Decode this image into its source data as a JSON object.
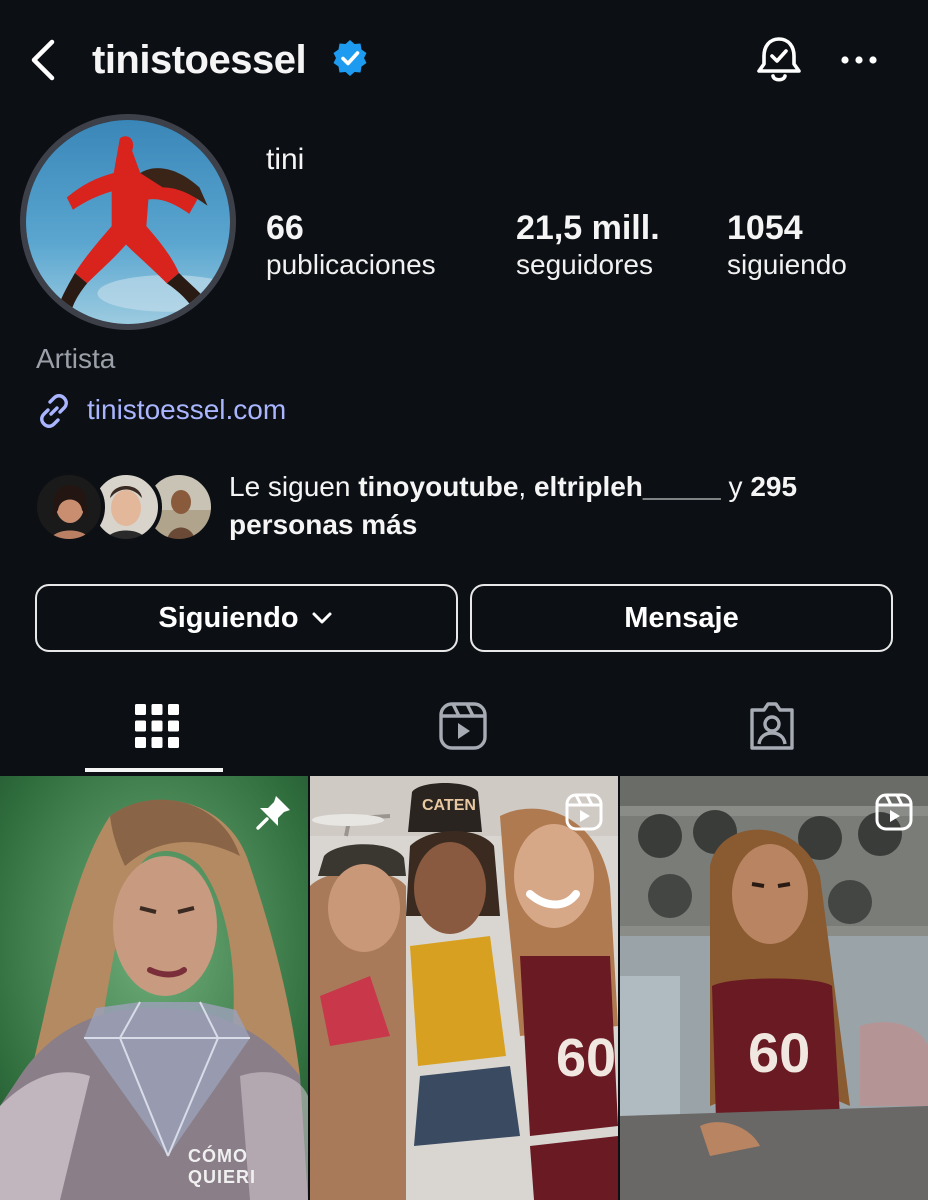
{
  "header": {
    "username": "tinistoessel",
    "icons": [
      "back-chevron-icon",
      "verified-badge-icon",
      "bell-check-icon",
      "more-dots-icon"
    ]
  },
  "profile": {
    "display_name": "tini",
    "stats": [
      {
        "value": "66",
        "label": "publicaciones"
      },
      {
        "value": "21,5 mill.",
        "label": "seguidores"
      },
      {
        "value": "1054",
        "label": "siguiendo"
      }
    ],
    "category": "Artista",
    "link": "tinistoessel.com"
  },
  "mutual": {
    "prefix": "Le siguen ",
    "user1": "tinoyoutube",
    "sep": ", ",
    "user2": "eltripleh_____",
    "middle": " y ",
    "count": "295",
    "suffix": "personas más"
  },
  "actions": {
    "follow_label": "Siguiendo",
    "message_label": "Mensaje"
  },
  "tabs": [
    "grid-icon",
    "reels-icon",
    "tagged-icon"
  ],
  "posts": [
    {
      "icon": "pin-icon",
      "caption": "CÓMO QUIERI"
    },
    {
      "icon": "reel-icon",
      "caption": ""
    },
    {
      "icon": "reel-icon",
      "caption": ""
    }
  ],
  "colors": {
    "background": "#0c0f14",
    "verified": "#1d9bf0",
    "link": "#a9b6ff",
    "muted": "#9ba0a8"
  }
}
